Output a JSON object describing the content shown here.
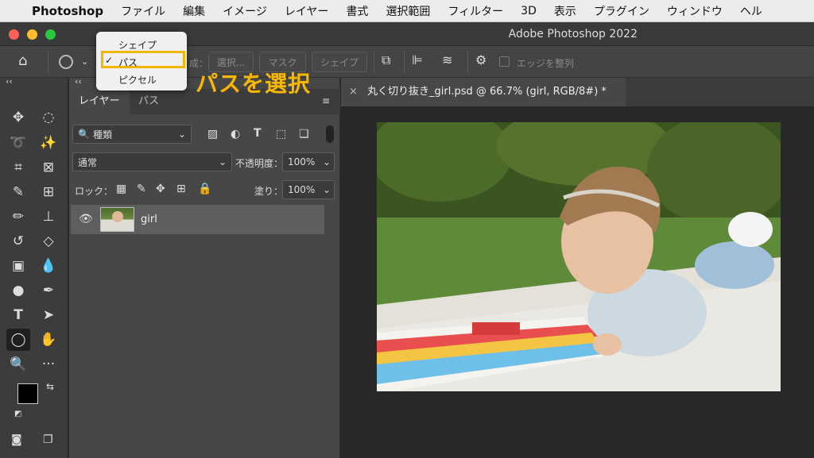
{
  "menubar": {
    "app_name": "Photoshop",
    "items": [
      "ファイル",
      "編集",
      "イメージ",
      "レイヤー",
      "書式",
      "選択範囲",
      "フィルター",
      "3D",
      "表示",
      "プラグイン",
      "ウィンドウ",
      "ヘル"
    ]
  },
  "window": {
    "title": "Adobe Photoshop 2022"
  },
  "options": {
    "make_label": "成：",
    "selection_btn": "選択...",
    "mask_btn": "マスク",
    "shape_btn": "シェイプ",
    "align_edges": "エッジを整列"
  },
  "mode_popup": {
    "items": [
      "シェイプ",
      "パス",
      "ピクセル"
    ],
    "selected": "パス",
    "check": "✓"
  },
  "annotation": "パスを選択",
  "layers_panel": {
    "tabs": [
      "レイヤー",
      "パス"
    ],
    "filter": "種類",
    "blend_mode": "通常",
    "opacity_label": "不透明度：",
    "opacity_value": "100%",
    "lock_label": "ロック：",
    "fill_label": "塗り：",
    "fill_value": "100%",
    "layers": [
      {
        "name": "girl",
        "visible": true
      }
    ]
  },
  "document": {
    "tab_title": "丸く切り抜き_girl.psd @ 66.7% (girl, RGB/8#) *"
  },
  "colors": {
    "accent_highlight": "#f2b500",
    "annotation_text": "#f9b800",
    "panel_bg": "#474747",
    "foreground": "#000000",
    "background": "#ffffff"
  }
}
